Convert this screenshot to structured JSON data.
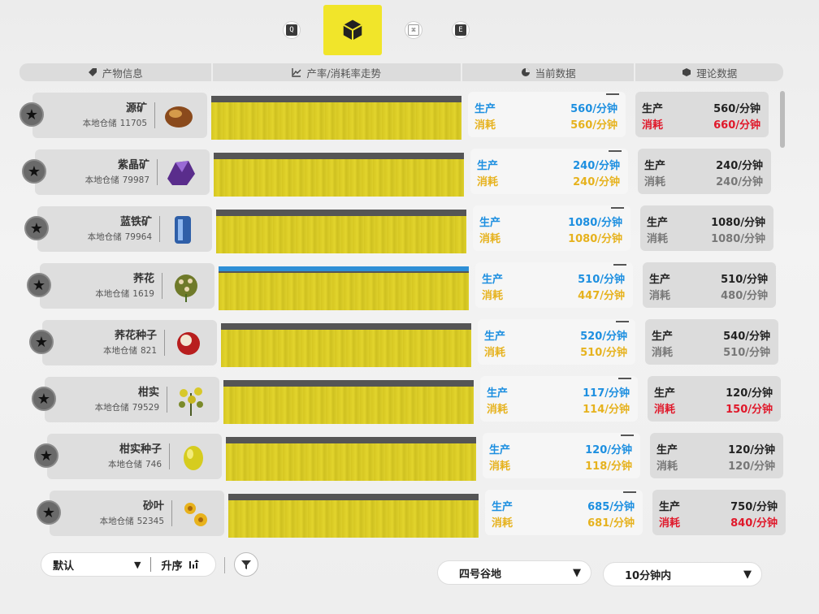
{
  "tabs": [
    {
      "glyph": "Q",
      "icon": "q-key-icon"
    },
    {
      "glyph": "",
      "icon": "cube-icon",
      "active": true
    },
    {
      "glyph": "⌘",
      "icon": "hex-icon"
    },
    {
      "glyph": "E",
      "icon": "e-key-icon"
    }
  ],
  "header": {
    "product_info": "产物信息",
    "trend": "产率/消耗率走势",
    "current": "当前数据",
    "theory": "理论数据"
  },
  "labels": {
    "stock_prefix": "本地仓储",
    "produce": "生产",
    "consume": "消耗"
  },
  "colors": {
    "accent_yellow": "#f1e52a",
    "produce_blue": "#1d8fe0",
    "consume_gold": "#e6b21e",
    "deficit_red": "#e0182a"
  },
  "items": [
    {
      "name": "源矿",
      "stock": "11705",
      "cur_prod": "560/分钟",
      "cur_cons": "560/分钟",
      "th_prod": "560/分钟",
      "th_cons": "660/分钟",
      "th_deficit": true,
      "icon": "ore-icon"
    },
    {
      "name": "紫晶矿",
      "stock": "79987",
      "cur_prod": "240/分钟",
      "cur_cons": "240/分钟",
      "th_prod": "240/分钟",
      "th_cons": "240/分钟",
      "th_deficit": false,
      "icon": "amethyst-icon"
    },
    {
      "name": "蓝铁矿",
      "stock": "79964",
      "cur_prod": "1080/分钟",
      "cur_cons": "1080/分钟",
      "th_prod": "1080/分钟",
      "th_cons": "1080/分钟",
      "th_deficit": false,
      "icon": "blue-iron-icon"
    },
    {
      "name": "荞花",
      "stock": "1619",
      "cur_prod": "510/分钟",
      "cur_cons": "447/分钟",
      "th_prod": "510/分钟",
      "th_cons": "480/分钟",
      "th_deficit": false,
      "icon": "buckwheat-flower-icon"
    },
    {
      "name": "荞花种子",
      "stock": "821",
      "cur_prod": "520/分钟",
      "cur_cons": "510/分钟",
      "th_prod": "540/分钟",
      "th_cons": "510/分钟",
      "th_deficit": false,
      "icon": "seed-icon"
    },
    {
      "name": "柑实",
      "stock": "79529",
      "cur_prod": "117/分钟",
      "cur_cons": "114/分钟",
      "th_prod": "120/分钟",
      "th_cons": "150/分钟",
      "th_deficit": true,
      "icon": "citrus-plant-icon"
    },
    {
      "name": "柑实种子",
      "stock": "746",
      "cur_prod": "120/分钟",
      "cur_cons": "118/分钟",
      "th_prod": "120/分钟",
      "th_cons": "120/分钟",
      "th_deficit": false,
      "icon": "citrus-seed-icon"
    },
    {
      "name": "砂叶",
      "stock": "52345",
      "cur_prod": "685/分钟",
      "cur_cons": "681/分钟",
      "th_prod": "750/分钟",
      "th_cons": "840/分钟",
      "th_deficit": true,
      "icon": "sand-leaf-icon"
    }
  ],
  "footer": {
    "sort_default": "默认",
    "sort_order": "升序",
    "area": "四号谷地",
    "time_range": "10分钟内"
  }
}
